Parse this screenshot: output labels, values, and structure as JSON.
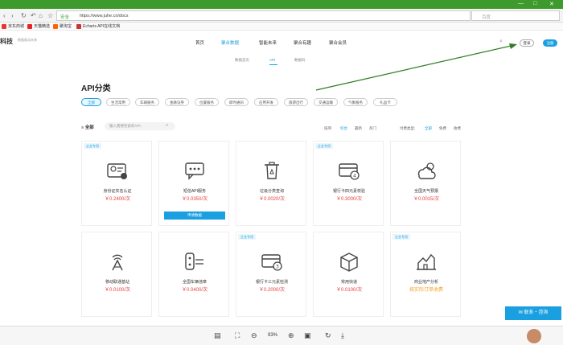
{
  "browser": {
    "window_controls": [
      "—",
      "□",
      "✕"
    ],
    "safe_label": "安全",
    "url": "https://www.juhe.cn/docs",
    "search_placeholder": "百度",
    "bookmarks": [
      "京东商城",
      "天猫精选",
      "聚淘宝",
      "Echarts API在线文档"
    ]
  },
  "site": {
    "logo": "科技",
    "logo_sub": "数据驱动未来",
    "nav": [
      "首页",
      "聚合数据",
      "智能未来",
      "聚合有趣",
      "聚合会员"
    ],
    "login": "登录",
    "register": "注册",
    "subnav": [
      "数据首页",
      "API",
      "数据码"
    ]
  },
  "main": {
    "title": "API分类",
    "categories": [
      "全部",
      "生活常用",
      "车辆服务",
      "金融证券",
      "位置服务",
      "即时通讯",
      "应用开发",
      "旅游出行",
      "交通运输",
      "气象服务",
      "礼品卡"
    ],
    "filter_label": "全部",
    "search_placeholder": "输入需要检索的API",
    "sort_label": "排序:",
    "sort_options": [
      "综合",
      "最新",
      "热门"
    ],
    "type_label": "付费类型:",
    "type_options": [
      "全部",
      "免费",
      "收费"
    ]
  },
  "cards": [
    {
      "tag": "企业专用",
      "name": "身份证实名认证",
      "price": "￥0.2400/次",
      "icon": "id-card-icon"
    },
    {
      "tag": "",
      "name": "短信API服务",
      "price": "￥0.0350/次",
      "icon": "message-icon",
      "button": "申请数据"
    },
    {
      "tag": "",
      "name": "垃圾分类查询",
      "price": "￥0.0020/次",
      "icon": "trash-icon"
    },
    {
      "tag": "企业专用",
      "name": "银行卡四元素校验",
      "price": "￥0.3000/次",
      "icon": "bank-card-icon"
    },
    {
      "tag": "",
      "name": "全国天气预报",
      "price": "￥0.0015/次",
      "icon": "weather-icon"
    },
    {
      "tag": "",
      "name": "移动联通基站",
      "price": "￥0.0100/次",
      "icon": "tower-icon"
    },
    {
      "tag": "",
      "name": "全国车辆违章",
      "price": "￥0.0400/次",
      "icon": "car-icon"
    },
    {
      "tag": "企业专用",
      "name": "银行卡三元素检测",
      "price": "￥0.2000/次",
      "icon": "bank-card-icon"
    },
    {
      "tag": "",
      "name": "常用快递",
      "price": "￥0.0100/次",
      "icon": "package-icon"
    },
    {
      "tag": "企业专用",
      "name": "商业地产分析",
      "price": "按实际订单收费",
      "icon": "chart-icon",
      "price_orange": true
    }
  ],
  "contact": "联系・咨询",
  "bottom_bar": {
    "zoom": "93%"
  },
  "colors": {
    "accent": "#1aa0e0",
    "price": "#e53c3c",
    "browser_green": "#3e9a2c"
  }
}
